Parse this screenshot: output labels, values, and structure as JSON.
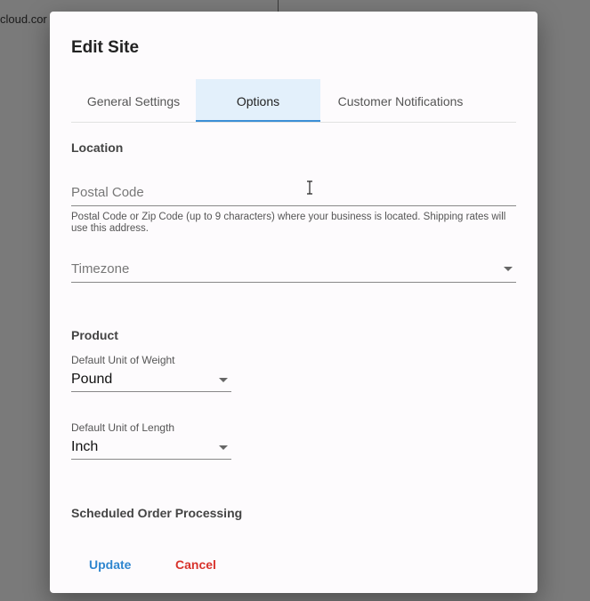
{
  "background": {
    "fragment_text": "cloud.cor"
  },
  "dialog": {
    "title": "Edit Site",
    "tabs": [
      {
        "label": "General Settings",
        "active": false
      },
      {
        "label": "Options",
        "active": true
      },
      {
        "label": "Customer Notifications",
        "active": false
      }
    ],
    "location": {
      "heading": "Location",
      "postal_placeholder": "Postal Code",
      "postal_helper": "Postal Code or Zip Code (up to 9 characters) where your business is located. Shipping rates will use this address.",
      "timezone_placeholder": "Timezone"
    },
    "product": {
      "heading": "Product",
      "weight_label": "Default Unit of Weight",
      "weight_value": "Pound",
      "length_label": "Default Unit of Length",
      "length_value": "Inch"
    },
    "scheduled": {
      "heading": "Scheduled Order Processing"
    },
    "actions": {
      "update_label": "Update",
      "cancel_label": "Cancel"
    }
  },
  "colors": {
    "accent": "#3b8fd6",
    "active_tab_bg": "#e3f0fb",
    "update": "#2f86cf",
    "cancel": "#d8332c"
  },
  "icons": [
    "dropdown-caret-icon",
    "text-cursor-icon"
  ]
}
